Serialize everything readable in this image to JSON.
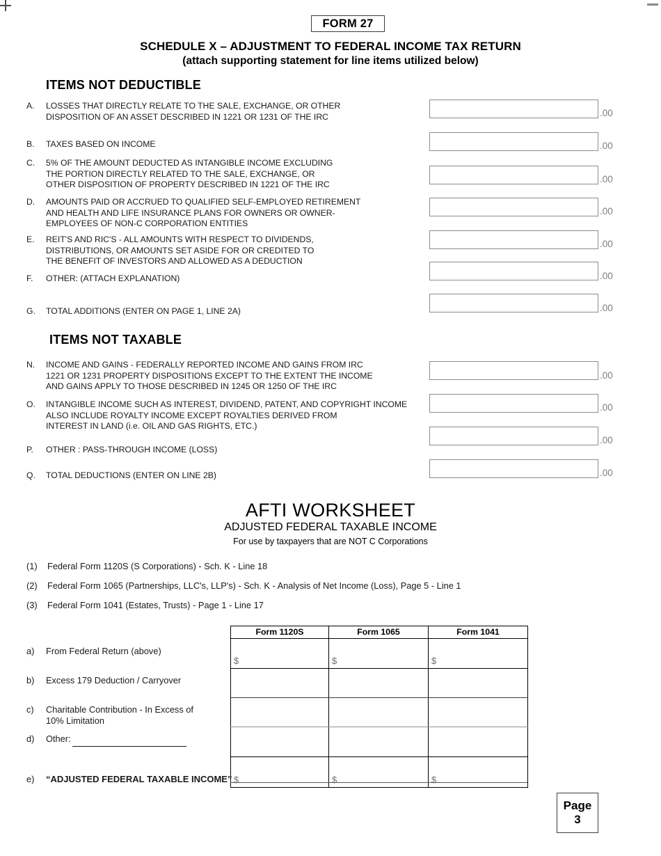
{
  "form_badge": "FORM 27",
  "titles": {
    "main": "SCHEDULE X – ADJUSTMENT TO FEDERAL INCOME TAX RETURN",
    "sub": "(attach supporting statement for line items utilized below)"
  },
  "sections": {
    "not_deductible_heading": "ITEMS NOT DEDUCTIBLE",
    "not_taxable_heading": "ITEMS NOT TAXABLE"
  },
  "cents_suffix": ".00",
  "not_deductible_items": [
    {
      "letter": "A.",
      "text": "LOSSES THAT DIRECTLY RELATE TO THE SALE, EXCHANGE, OR OTHER\nDISPOSITION OF AN ASSET DESCRIBED IN 1221 OR 1231 OF THE IRC",
      "value": ""
    },
    {
      "letter": "B.",
      "text": "TAXES BASED ON INCOME",
      "value": ""
    },
    {
      "letter": "C.",
      "text": "5% OF THE AMOUNT DEDUCTED AS INTANGIBLE INCOME EXCLUDING\nTHE PORTION DIRECTLY RELATED TO THE SALE, EXCHANGE, OR\nOTHER DISPOSITION OF PROPERTY DESCRIBED IN 1221 OF THE IRC",
      "value": ""
    },
    {
      "letter": "D.",
      "text": "AMOUNTS PAID OR ACCRUED TO QUALIFIED SELF-EMPLOYED RETIREMENT\nAND HEALTH AND LIFE INSURANCE PLANS FOR OWNERS OR OWNER-\nEMPLOYEES OF NON-C CORPORATION ENTITIES",
      "value": ""
    },
    {
      "letter": "E.",
      "text": "REIT'S AND RIC'S - ALL AMOUNTS WITH RESPECT TO DIVIDENDS,\nDISTRIBUTIONS, OR AMOUNTS SET ASIDE FOR OR CREDITED TO\nTHE BENEFIT OF INVESTORS AND ALLOWED AS A DEDUCTION",
      "value": ""
    },
    {
      "letter": "F.",
      "text": "OTHER: (ATTACH EXPLANATION)",
      "value": ""
    },
    {
      "letter": "G.",
      "text": "TOTAL ADDITIONS (ENTER ON PAGE 1, LINE 2A)",
      "value": ""
    }
  ],
  "not_taxable_items": [
    {
      "letter": "N.",
      "text": "INCOME AND GAINS - FEDERALLY REPORTED INCOME AND GAINS FROM IRC\n1221 OR 1231 PROPERTY DISPOSITIONS EXCEPT TO THE EXTENT THE INCOME\nAND GAINS APPLY TO THOSE DESCRIBED IN 1245 OR 1250 OF THE IRC",
      "value": ""
    },
    {
      "letter": "O.",
      "text": "INTANGIBLE INCOME SUCH AS INTEREST, DIVIDEND, PATENT, AND COPYRIGHT INCOME\nALSO INCLUDE ROYALTY INCOME EXCEPT ROYALTIES DERIVED FROM\nINTEREST IN LAND (i.e. OIL AND GAS RIGHTS, ETC.)",
      "value": ""
    },
    {
      "letter": "P.",
      "text": "OTHER :  PASS-THROUGH INCOME (LOSS)",
      "value": ""
    },
    {
      "letter": "Q.",
      "text": "TOTAL DEDUCTIONS (ENTER ON LINE 2B)",
      "value": ""
    }
  ],
  "afti": {
    "title": "AFTI WORKSHEET",
    "subtitle": "ADJUSTED FEDERAL TAXABLE INCOME",
    "note": "For use by taxpayers that are NOT C Corporations",
    "references": [
      {
        "num": "(1)",
        "text": "Federal Form 1120S (S Corporations) - Sch. K - Line 18"
      },
      {
        "num": "(2)",
        "text": "Federal Form 1065 (Partnerships, LLC's, LLP's) - Sch. K - Analysis of Net Income (Loss), Page 5 - Line 1"
      },
      {
        "num": "(3)",
        "text": "Federal Form 1041 (Estates, Trusts) - Page 1 - Line 17"
      }
    ],
    "table": {
      "columns": [
        "Form 1120S",
        "Form 1065",
        "Form 1041"
      ],
      "rows": [
        {
          "num": "a)",
          "label": "From Federal Return (above)",
          "cells": [
            "$",
            "$",
            "$"
          ]
        },
        {
          "num": "b)",
          "label": "Excess 179 Deduction / Carryover",
          "cells": [
            "",
            "",
            ""
          ]
        },
        {
          "num": "c)",
          "label": "Charitable Contribution - In Excess of\n10% Limitation",
          "cells": [
            "",
            "",
            ""
          ]
        },
        {
          "num": "d)",
          "label": "Other:",
          "cells": [
            "",
            "",
            ""
          ]
        },
        {
          "num": "e)",
          "label": "“ADJUSTED FEDERAL TAXABLE INCOME”",
          "cells": [
            "$",
            "$",
            "$"
          ]
        }
      ]
    }
  },
  "page_badge": {
    "word": "Page",
    "number": "3"
  }
}
